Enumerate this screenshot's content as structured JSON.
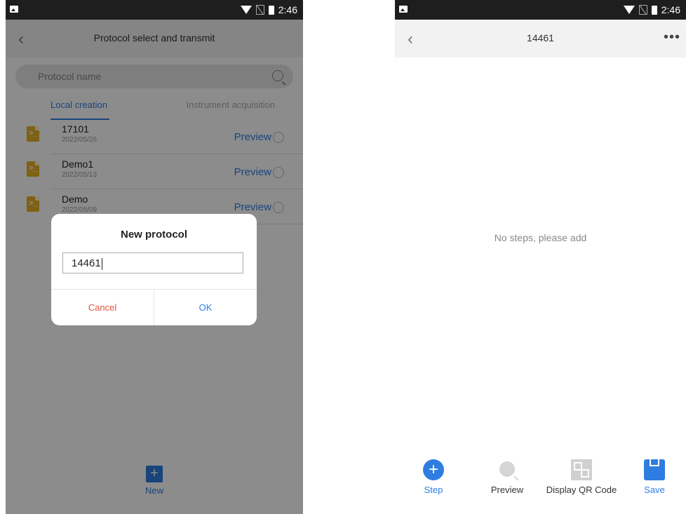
{
  "left": {
    "status_time": "2:46",
    "title": "Protocol select and transmit",
    "search_placeholder": "Protocol name",
    "tabs": [
      "Local creation",
      "Instrument acquisition"
    ],
    "items": [
      {
        "name": "17101",
        "date": "2022/05/26",
        "action": "Preview"
      },
      {
        "name": "Demo1",
        "date": "2022/05/13",
        "action": "Preview"
      },
      {
        "name": "Demo",
        "date": "2022/05/09",
        "action": "Preview"
      }
    ],
    "new_label": "New",
    "dialog": {
      "title": "New protocol",
      "input_value": "14461",
      "cancel": "Cancel",
      "ok": "OK"
    }
  },
  "right": {
    "status_time": "2:46",
    "title": "14461",
    "more": "•••",
    "empty_message": "No steps, please add",
    "toolbar": {
      "step": "Step",
      "preview": "Preview",
      "qr": "Display QR Code",
      "save": "Save"
    }
  },
  "colors": {
    "accent": "#2f7de1",
    "cancel": "#e0533d",
    "file_icon": "#e6b122",
    "status_bar": "#1e1e1e"
  }
}
